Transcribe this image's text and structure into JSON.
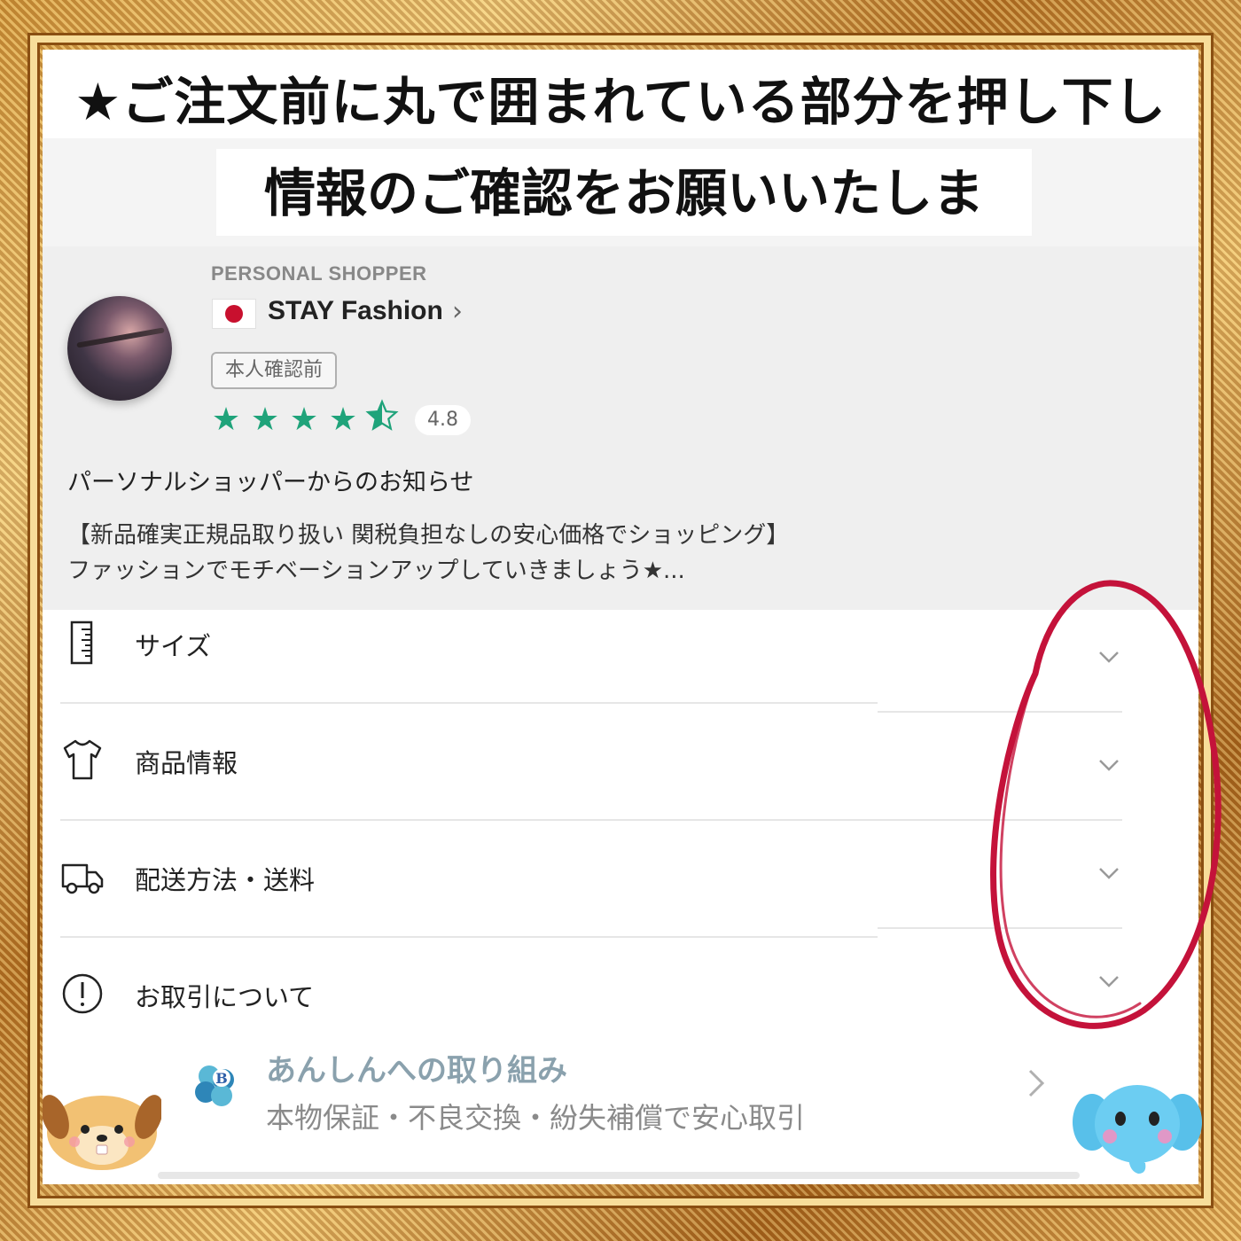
{
  "instruction": {
    "line1": "★ご注文前に丸で囲まれている部分を押し下し",
    "line2": "情報のご確認をお願いいたします。"
  },
  "shopper": {
    "section_label": "PERSONAL SHOPPER",
    "flag_icon": "japan-flag-icon",
    "name": "STAY Fashion",
    "chevron": "›",
    "verify_badge": "本人確認前",
    "rating_stars": 4.5,
    "rating_max": 5,
    "rating_value": "4.8",
    "star_color": "#1fa37a"
  },
  "notice": {
    "title": "パーソナルショッパーからのお知らせ",
    "line1": "【新品確実正規品取り扱い 関税負担なしの安心価格でショッピング】",
    "line2": "ファッションでモチベーションアップしていきましょう★..."
  },
  "accordion": [
    {
      "label": "サイズ",
      "icon": "ruler-icon"
    },
    {
      "label": "商品情報",
      "icon": "tshirt-icon"
    },
    {
      "label": "配送方法・送料",
      "icon": "truck-icon"
    },
    {
      "label": "お取引について",
      "icon": "info-circle-icon"
    }
  ],
  "ansin": {
    "title": "あんしんへの取り組み",
    "subtitle": "本物保証・不良交換・紛失補償で安心取引",
    "logo_icon": "clover-b-logo-icon"
  },
  "colors": {
    "highlight_circle": "#c4123a",
    "frame_gold": "#d59a3c"
  }
}
